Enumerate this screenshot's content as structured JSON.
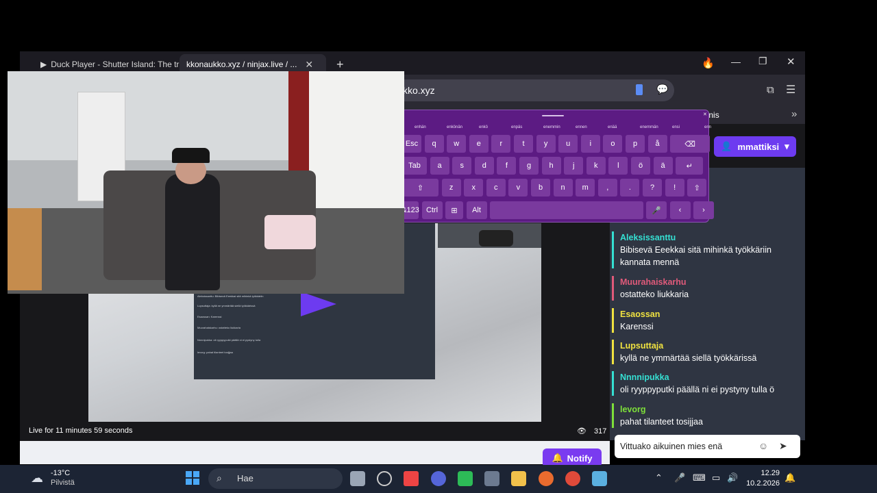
{
  "browser": {
    "tabs": [
      {
        "label": "Duck Player - Shutter Island: The tr"
      },
      {
        "label": "kkonaukko.xyz / ninjax.live / ..."
      }
    ],
    "new_tab_label": "+",
    "url": "kko.xyz",
    "bookmark_tennis": "Tennis",
    "overflow": "»"
  },
  "page": {
    "login_label": "mmattiksi",
    "live_status": "Live for 11 minutes 59 seconds",
    "viewers": "317",
    "notify_label": "Notify"
  },
  "chat": {
    "messages": [
      {
        "user": "Aleksissanttu",
        "color": "#35e0d3",
        "text": "Bibisevä Eeekkai sitä mihinkä työkkäriin kannata mennä"
      },
      {
        "user": "Muurahaiskarhu",
        "color": "#e05a7a",
        "text": "ostatteko liukkaria"
      },
      {
        "user": "Esaossan",
        "color": "#f1e340",
        "text": "Karenssi"
      },
      {
        "user": "Lupsuttaja",
        "color": "#f1e340",
        "text": "kyllä ne ymmärtää siellä työkkärissä"
      },
      {
        "user": "Nnnnipukka",
        "color": "#35e0d3",
        "text": "oli ryyppyputki päällä ni ei pystyny tulla ö"
      },
      {
        "user": "levorg",
        "color": "#7ee03a",
        "text": "pahat tilanteet tosijjaa"
      }
    ],
    "input_value": "Vittuako aikuinen mies enä"
  },
  "keyboard": {
    "suggestions": [
      "enhän",
      "enkönän",
      "enkö",
      "enpäs",
      "enemmin",
      "ennen",
      "enää",
      "enemmän",
      "ensi",
      "enn"
    ],
    "row1": [
      "Esc",
      "q",
      "w",
      "e",
      "r",
      "t",
      "y",
      "u",
      "i",
      "o",
      "p",
      "å",
      "⌫"
    ],
    "row2": [
      "Tab",
      "a",
      "s",
      "d",
      "f",
      "g",
      "h",
      "j",
      "k",
      "l",
      "ö",
      "ä",
      "↵"
    ],
    "row3": [
      "⇧",
      "z",
      "x",
      "c",
      "v",
      "b",
      "n",
      "m",
      ",",
      ".",
      "?",
      "!",
      "⇧"
    ],
    "row4": [
      "&123",
      "Ctrl",
      "⊞",
      "Alt",
      " ",
      "🎤",
      "‹",
      "›"
    ]
  },
  "taskbar": {
    "temp": "-13°C",
    "weather": "Pilvistä",
    "search_placeholder": "Hae",
    "time": "12.29",
    "date": "10.2.2026"
  },
  "embedded_chat_lines": [
    "Aleksissanttu: Bibisevä Eeekkai sitä mihinkä työkkäriin",
    "Lupsuttaja: kyllä ne ymmärtää siellä työkkärissä",
    "Esaossan: Karenssi",
    "Muurahaiskarhu: ostatteko liukkaria",
    "Nnnnipukka: oli ryyppyputki päällä ni ei pystyny tulla",
    "levorg: pahat tilanteet tosijjaa"
  ],
  "colors": {
    "accent": "#6d3bf0",
    "keyboard": "#5c1b83",
    "chat_bg": "#2f3542"
  }
}
